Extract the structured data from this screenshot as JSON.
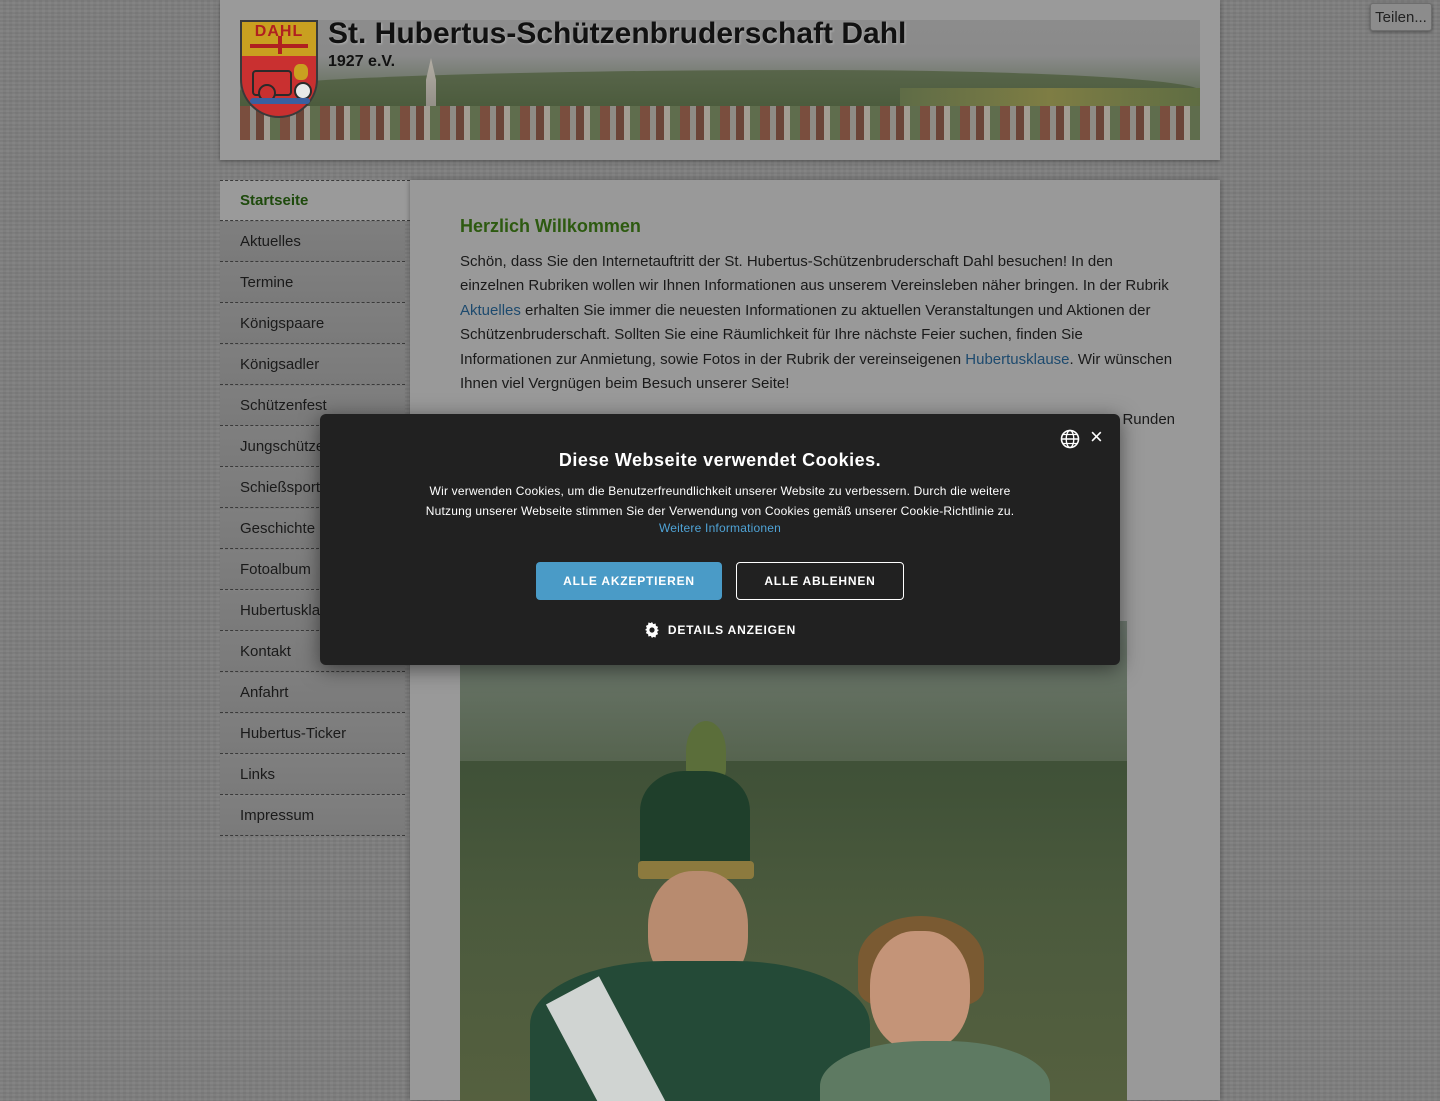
{
  "header": {
    "title": "St. Hubertus-Schützenbruderschaft Dahl",
    "subtitle": "1927 e.V.",
    "crest_text": "DAHL"
  },
  "share": {
    "label": "Teilen..."
  },
  "nav": {
    "items": [
      {
        "label": "Startseite",
        "active": true
      },
      {
        "label": "Aktuelles"
      },
      {
        "label": "Termine"
      },
      {
        "label": "Königspaare"
      },
      {
        "label": "Königsadler"
      },
      {
        "label": "Schützenfest"
      },
      {
        "label": "Jungschützen"
      },
      {
        "label": "Schießsport"
      },
      {
        "label": "Geschichte"
      },
      {
        "label": "Fotoalbum"
      },
      {
        "label": "Hubertusklause"
      },
      {
        "label": "Kontakt"
      },
      {
        "label": "Anfahrt"
      },
      {
        "label": "Hubertus-Ticker"
      },
      {
        "label": "Links"
      },
      {
        "label": "Impressum"
      }
    ]
  },
  "main": {
    "heading": "Herzlich Willkommen",
    "intro_part1": "Schön, dass Sie den Internetauftritt der St. Hubertus-Schützenbruderschaft Dahl besuchen! In den einzelnen Rubriken wollen wir Ihnen Informationen aus unserem Vereinsleben näher bringen. In der Rubrik ",
    "intro_link1": "Aktuelles",
    "intro_part2": " erhalten Sie immer die neuesten Informationen zu aktuellen Veranstaltungen und Aktionen der Schützenbruderschaft. Sollten Sie eine Räumlichkeit für Ihre nächste Feier suchen, finden Sie Informationen zur Anmietung, sowie Fotos in der Rubrik der vereinseigenen ",
    "intro_link2": "Hubertusklause",
    "intro_part3": ". Wir wünschen Ihnen viel Vergnügen beim Besuch unserer Seite!",
    "second_paragraph_visible_end": "Runden"
  },
  "cookie": {
    "title": "Diese Webseite verwendet Cookies.",
    "text": "Wir verwenden Cookies, um die Benutzerfreundlichkeit unserer Website zu verbessern. Durch die weitere Nutzung unserer Webseite stimmen Sie der Verwendung von Cookies gemäß unserer Cookie-Richtlinie zu.",
    "more_link": "Weitere Informationen",
    "accept_label": "ALLE AKZEPTIEREN",
    "reject_label": "ALLE ABLEHNEN",
    "details_label": "DETAILS ANZEIGEN",
    "close_symbol": "×",
    "accent_color": "#4a9bc7",
    "icons": [
      "globe-icon",
      "close-icon",
      "gear-icon"
    ]
  }
}
